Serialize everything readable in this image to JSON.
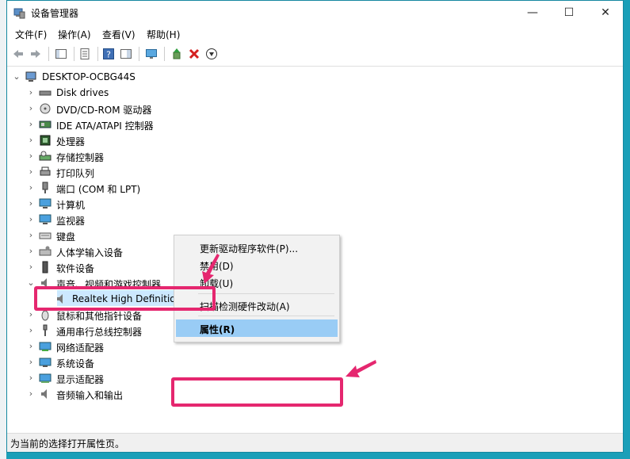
{
  "window": {
    "title": "设备管理器",
    "controls": {
      "minimize": "—",
      "maximize": "☐",
      "close": "✕"
    }
  },
  "menus": [
    "文件(F)",
    "操作(A)",
    "查看(V)",
    "帮助(H)"
  ],
  "tree": {
    "root": "DESKTOP-OCBG44S",
    "items": [
      "Disk drives",
      "DVD/CD-ROM 驱动器",
      "IDE ATA/ATAPI 控制器",
      "处理器",
      "存储控制器",
      "打印队列",
      "端口 (COM 和 LPT)",
      "计算机",
      "监视器",
      "键盘",
      "人体学输入设备",
      "软件设备",
      "声音、视频和游戏控制器",
      "Realtek High Definition Audio",
      "鼠标和其他指针设备",
      "通用串行总线控制器",
      "网络适配器",
      "系统设备",
      "显示适配器",
      "音频输入和输出"
    ]
  },
  "context_menu": {
    "items": [
      "更新驱动程序软件(P)...",
      "禁用(D)",
      "卸载(U)",
      "扫描检测硬件改动(A)",
      "属性(R)"
    ]
  },
  "status": {
    "text": "为当前的选择打开属性页。"
  },
  "colors": {
    "accent": "#e5276f",
    "selection": "#cce8ff",
    "menu_highlight": "#99ccf5"
  }
}
